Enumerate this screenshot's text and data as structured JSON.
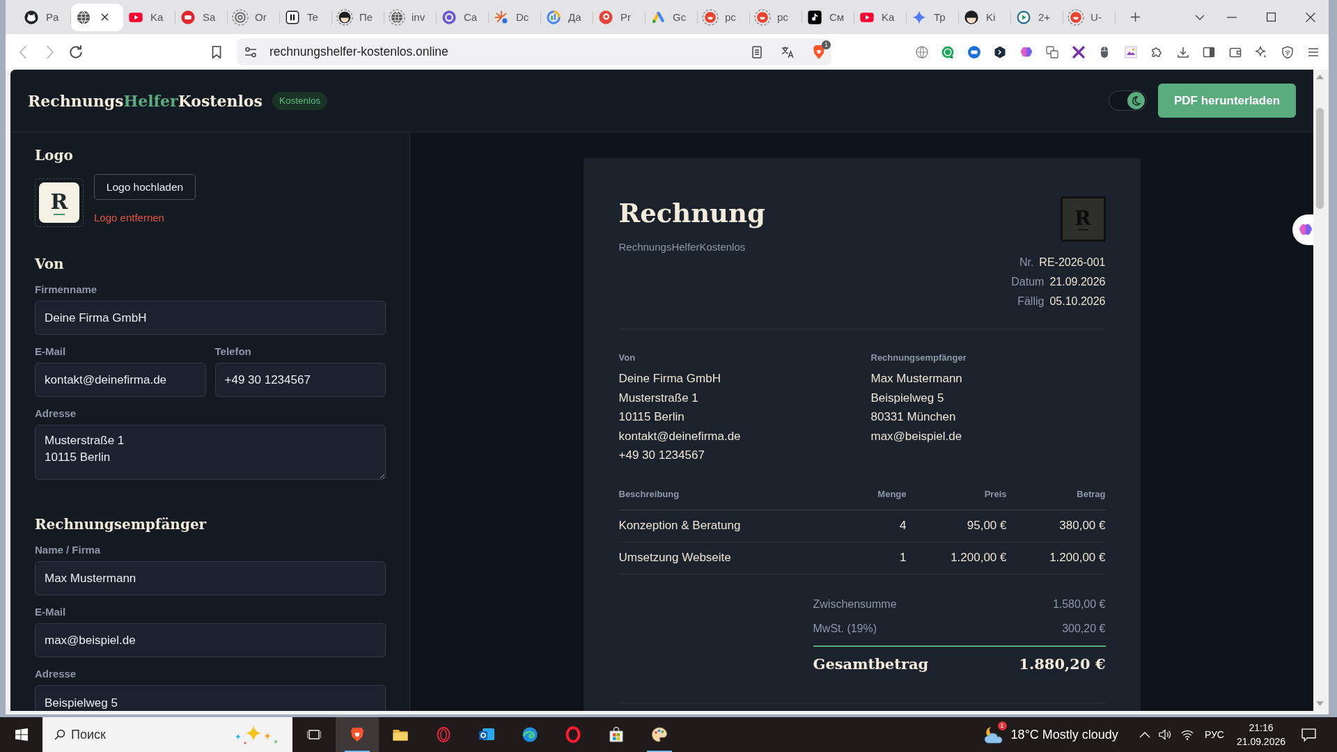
{
  "browser": {
    "tabs": [
      {
        "title": "Pa",
        "selected": false
      },
      {
        "selected": true
      },
      {
        "title": "Ka",
        "selected": false
      },
      {
        "title": "Sa",
        "selected": false
      },
      {
        "title": "Or",
        "selected": false
      },
      {
        "title": "Te",
        "selected": false
      },
      {
        "title": "Пе",
        "selected": false
      },
      {
        "title": "inv",
        "selected": false
      },
      {
        "title": "Ca",
        "selected": false
      },
      {
        "title": "Dc",
        "selected": false
      },
      {
        "title": "Да",
        "selected": false
      },
      {
        "title": "Pr",
        "selected": false
      },
      {
        "title": "Gc",
        "selected": false
      },
      {
        "title": "pc",
        "selected": false
      },
      {
        "title": "pc",
        "selected": false
      },
      {
        "title": "См",
        "selected": false
      },
      {
        "title": "Ka",
        "selected": false
      },
      {
        "title": "Тр",
        "selected": false
      },
      {
        "title": "Ki",
        "selected": false
      },
      {
        "title": "2+",
        "selected": false
      },
      {
        "title": "U-",
        "selected": false
      }
    ],
    "back": {
      "disabled": true
    },
    "forward": {
      "disabled": true
    },
    "address": "rechnungshelfer-kostenlos.online",
    "shields_badge": "1"
  },
  "header": {
    "brand": [
      {
        "text": "Rechnungs",
        "accent": false
      },
      {
        "text": "Helfer",
        "accent": true
      },
      {
        "text": "Kostenlos",
        "accent": false
      }
    ],
    "badge": "Kostenlos",
    "theme_toggle": {
      "on": true
    },
    "download_button": "PDF herunterladen"
  },
  "editor": {
    "logo": {
      "heading": "Logo",
      "letter": "R",
      "upload_button": "Logo hochladen",
      "remove_link": "Logo entfernen"
    },
    "sections": [
      {
        "heading": "Von",
        "rows": [
          {
            "fields": [
              {
                "label": "Firmenname",
                "value": "Deine Firma GmbH",
                "kind": "input"
              }
            ]
          },
          {
            "fields": [
              {
                "label": "E-Mail",
                "value": "kontakt@deinefirma.de",
                "kind": "input"
              },
              {
                "label": "Telefon",
                "value": "+49 30 1234567",
                "kind": "input"
              }
            ]
          },
          {
            "fields": [
              {
                "label": "Adresse",
                "value": "Musterstraße 1\n10115 Berlin",
                "kind": "textarea"
              }
            ]
          }
        ]
      },
      {
        "heading": "Rechnungsempfänger",
        "rows": [
          {
            "fields": [
              {
                "label": "Name / Firma",
                "value": "Max Mustermann",
                "kind": "input"
              }
            ]
          },
          {
            "fields": [
              {
                "label": "E-Mail",
                "value": "max@beispiel.de",
                "kind": "input"
              }
            ]
          },
          {
            "fields": [
              {
                "label": "Adresse",
                "value": "Beispielweg 5",
                "kind": "textarea"
              }
            ]
          }
        ]
      }
    ]
  },
  "invoice": {
    "title": "Rechnung",
    "company": "RechnungsHelferKostenlos",
    "logo_letter": "R",
    "meta": [
      {
        "label": "Nr.",
        "value": "RE-2026-001"
      },
      {
        "label": "Datum",
        "value": "21.09.2026"
      },
      {
        "label": "Fällig",
        "value": "05.10.2026"
      }
    ],
    "from": {
      "heading": "Von",
      "lines": [
        "Deine Firma GmbH",
        "Musterstraße 1",
        "10115 Berlin",
        "kontakt@deinefirma.de",
        "+49 30 1234567"
      ]
    },
    "to": {
      "heading": "Rechnungsempfänger",
      "lines": [
        "Max Mustermann",
        "Beispielweg 5",
        "80331 München",
        "max@beispiel.de"
      ]
    },
    "table": {
      "columns": [
        "Beschreibung",
        "Menge",
        "Preis",
        "Betrag"
      ],
      "rows": [
        [
          "Konzeption & Beratung",
          "4",
          "95,00 €",
          "380,00 €"
        ],
        [
          "Umsetzung Webseite",
          "1",
          "1.200,00 €",
          "1.200,00 €"
        ]
      ]
    },
    "totals": [
      {
        "label": "Zwischensumme",
        "value": "1.580,00 €",
        "kind": "sub"
      },
      {
        "label": "MwSt. (19%)",
        "value": "300,20 €",
        "kind": "sub"
      },
      {
        "label": "Gesamtbetrag",
        "value": "1.880,20 €",
        "kind": "grand"
      }
    ]
  },
  "taskbar": {
    "search_placeholder": "Поиск",
    "apps": [
      {
        "selected": true,
        "running": true
      },
      {
        "selected": false,
        "running": false
      },
      {
        "selected": false,
        "running": false
      },
      {
        "selected": false,
        "running": false
      },
      {
        "selected": false,
        "running": false
      },
      {
        "selected": false,
        "running": false
      },
      {
        "selected": false,
        "running": false
      },
      {
        "selected": false,
        "running": true
      }
    ],
    "weather": {
      "temperature": "18°C",
      "condition": "Mostly cloudy",
      "badge": "1"
    },
    "language": "РУС",
    "time": "21:16",
    "date": "21.09.2026"
  }
}
